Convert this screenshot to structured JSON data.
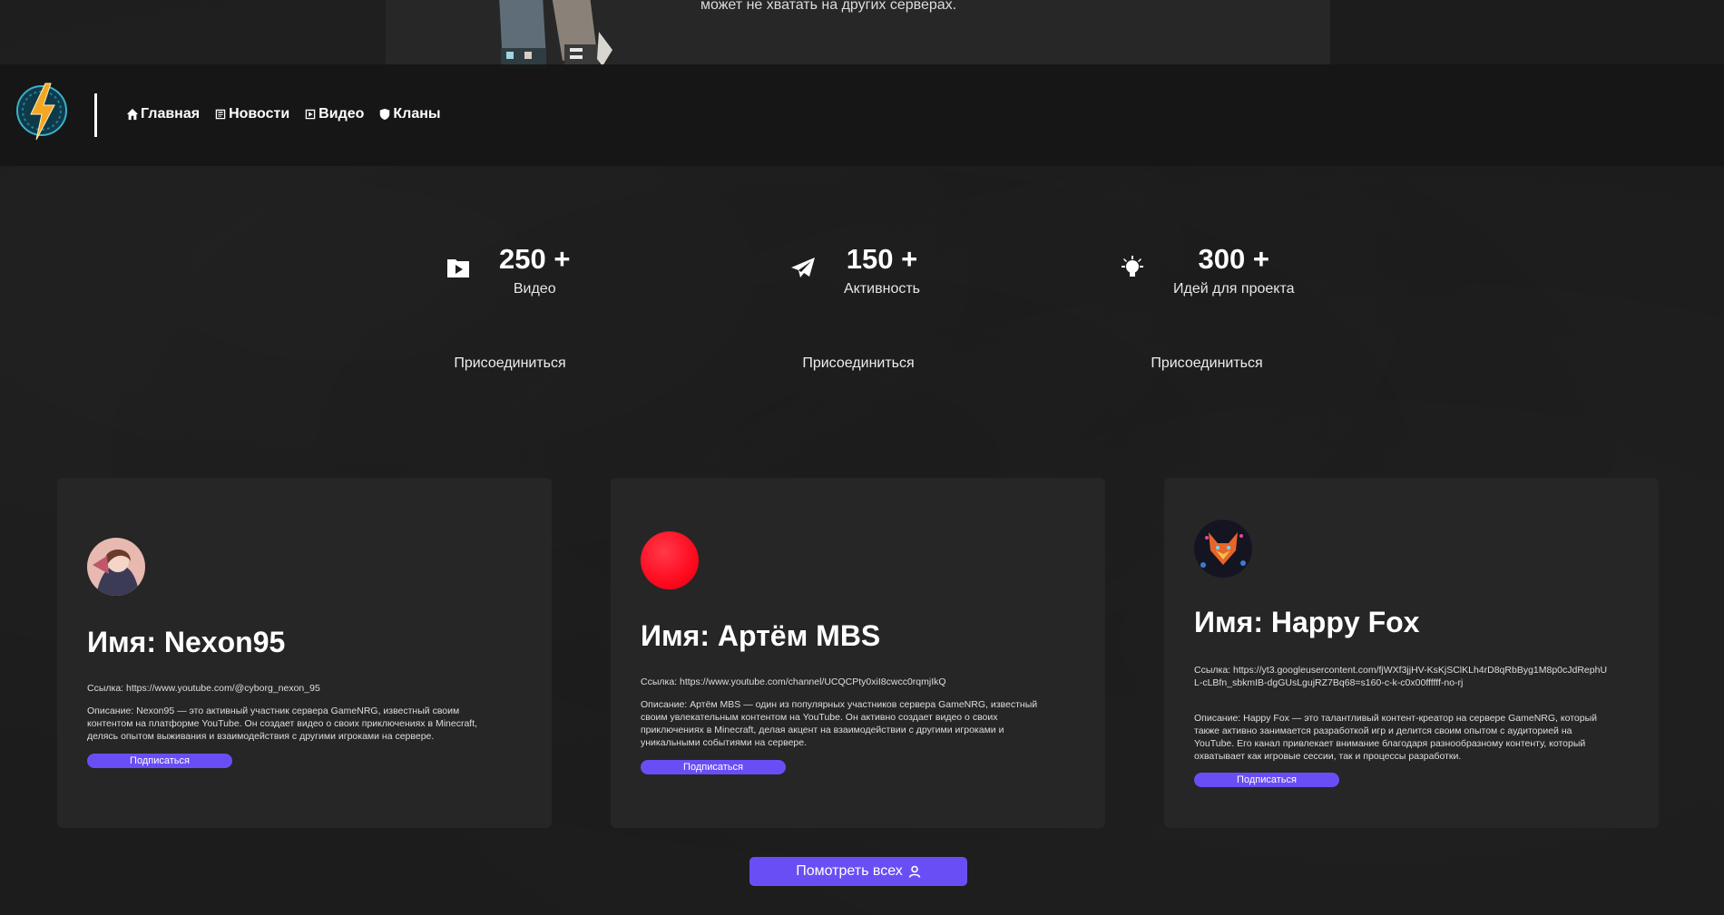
{
  "hero": {
    "text": "может не хватать на других серверах."
  },
  "nav": {
    "items": [
      {
        "icon": "home-icon",
        "label": "Главная"
      },
      {
        "icon": "news-icon",
        "label": "Новости"
      },
      {
        "icon": "video-icon",
        "label": "Видео"
      },
      {
        "icon": "shield-icon",
        "label": "Кланы"
      }
    ]
  },
  "stats": [
    {
      "icon": "play-icon",
      "value": "250 +",
      "label": "Видео",
      "join": "Присоединиться"
    },
    {
      "icon": "telegram-icon",
      "value": "150 +",
      "label": "Активность",
      "join": "Присоединиться"
    },
    {
      "icon": "lightbulb-icon",
      "value": "300 +",
      "label": "Идей для проекта",
      "join": "Присоединиться"
    }
  ],
  "creators": [
    {
      "name": "Имя: Nexon95",
      "link": "Ссылка: https://www.youtube.com/@cyborg_nexon_95",
      "description": "Описание: Nexon95 — это активный участник сервера GameNRG, известный своим контентом на платформе YouTube. Он создает видео о своих приключениях в Minecraft, делясь опытом выживания и взаимодействия с другими игроками на сервере.",
      "subscribe": "Подписаться"
    },
    {
      "name": "Имя: Артём MBS",
      "link": "Ссылка: https://www.youtube.com/channel/UCQCPty0xiI8cwcc0rqmjIkQ",
      "description": "Описание: Артём MBS — один из популярных участников сервера GameNRG, известный своим увлекательным контентом на YouTube. Он активно создает видео о своих приключениях в Minecraft, делая акцент на взаимодействии с другими игроками и уникальными событиями на сервере.",
      "subscribe": "Подписаться"
    },
    {
      "name": "Имя: Happy Fox",
      "link": "Ссылка: https://yt3.googleusercontent.com/fjWXf3jjHV-KsKjSClKLh4rD8qRbByg1M8p0cJdRephUL-cLBfn_sbkmIB-dgGUsLgujRZ7Bq68=s160-c-k-c0x00ffffff-no-rj",
      "description": "Описание: Happy Fox — это талантливый контент-креатор на сервере GameNRG, который также активно занимается разработкой игр и делится своим опытом с аудиторией на YouTube. Его канал привлекает внимание благодаря разнообразному контенту, который охватывает как игровые сессии, так и процессы разработки.",
      "subscribe": "Подписаться"
    }
  ],
  "view_all": {
    "label": "Помотреть всех",
    "icon": "user-icon"
  },
  "colors": {
    "accent": "#6a4ef5",
    "background": "#1c1c1c",
    "card": "#262626",
    "red_avatar": "#ff0a1e"
  }
}
